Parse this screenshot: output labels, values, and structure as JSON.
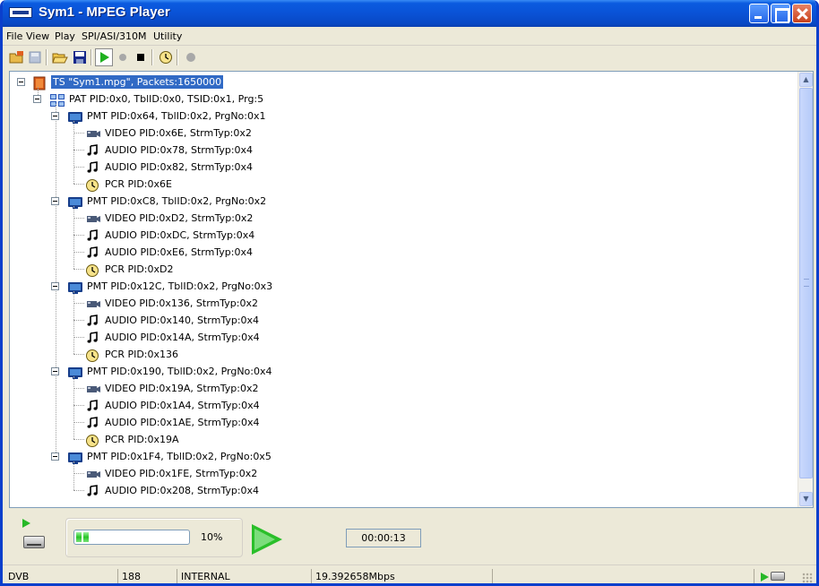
{
  "window": {
    "title": "Sym1 - MPEG Player"
  },
  "menu": [
    {
      "label": "File",
      "name": "menu-file"
    },
    {
      "label": "View",
      "name": "menu-view"
    },
    {
      "label": "Play",
      "name": "menu-play"
    },
    {
      "label": "SPI/ASI/310M",
      "name": "menu-spi-asi-310m"
    },
    {
      "label": "Utility",
      "name": "menu-utility"
    }
  ],
  "toolbar": {
    "icons": [
      "open-stream-icon",
      "save-disabled-icon",
      "open-folder-icon",
      "save-icon",
      "play-icon",
      "record-icon",
      "stop-icon",
      "timer-icon",
      "record-disabled-icon"
    ]
  },
  "tree": {
    "root": "TS \"Sym1.mpg\", Packets:1650000",
    "pat": "PAT PID:0x0, TblID:0x0, TSID:0x1, Prg:5",
    "programs": [
      {
        "label": "PMT PID:0x64, TblID:0x2, PrgNo:0x1",
        "streams": [
          {
            "kind": "video",
            "label": "VIDEO PID:0x6E, StrmTyp:0x2"
          },
          {
            "kind": "audio",
            "label": "AUDIO PID:0x78, StrmTyp:0x4"
          },
          {
            "kind": "audio",
            "label": "AUDIO PID:0x82, StrmTyp:0x4"
          },
          {
            "kind": "pcr",
            "label": "PCR PID:0x6E"
          }
        ]
      },
      {
        "label": "PMT PID:0xC8, TblID:0x2, PrgNo:0x2",
        "streams": [
          {
            "kind": "video",
            "label": "VIDEO PID:0xD2, StrmTyp:0x2"
          },
          {
            "kind": "audio",
            "label": "AUDIO PID:0xDC, StrmTyp:0x4"
          },
          {
            "kind": "audio",
            "label": "AUDIO PID:0xE6, StrmTyp:0x4"
          },
          {
            "kind": "pcr",
            "label": "PCR PID:0xD2"
          }
        ]
      },
      {
        "label": "PMT PID:0x12C, TblID:0x2, PrgNo:0x3",
        "streams": [
          {
            "kind": "video",
            "label": "VIDEO PID:0x136, StrmTyp:0x2"
          },
          {
            "kind": "audio",
            "label": "AUDIO PID:0x140, StrmTyp:0x4"
          },
          {
            "kind": "audio",
            "label": "AUDIO PID:0x14A, StrmTyp:0x4"
          },
          {
            "kind": "pcr",
            "label": "PCR PID:0x136"
          }
        ]
      },
      {
        "label": "PMT PID:0x190, TblID:0x2, PrgNo:0x4",
        "streams": [
          {
            "kind": "video",
            "label": "VIDEO PID:0x19A, StrmTyp:0x2"
          },
          {
            "kind": "audio",
            "label": "AUDIO PID:0x1A4, StrmTyp:0x4"
          },
          {
            "kind": "audio",
            "label": "AUDIO PID:0x1AE, StrmTyp:0x4"
          },
          {
            "kind": "pcr",
            "label": "PCR PID:0x19A"
          }
        ]
      },
      {
        "label": "PMT PID:0x1F4, TblID:0x2, PrgNo:0x5",
        "streams": [
          {
            "kind": "video",
            "label": "VIDEO PID:0x1FE, StrmTyp:0x2"
          },
          {
            "kind": "audio",
            "label": "AUDIO PID:0x208, StrmTyp:0x4"
          }
        ]
      }
    ]
  },
  "player": {
    "progress_percent": 10,
    "progress_label": "10%",
    "elapsed": "00:00:13"
  },
  "status": {
    "standard": "DVB",
    "packet_size": "188",
    "clock": "INTERNAL",
    "bitrate": "19.392658Mbps"
  },
  "colors": {
    "titlebar": "#0a52d6",
    "selection": "#316ac5",
    "play_green": "#2abf2a"
  }
}
